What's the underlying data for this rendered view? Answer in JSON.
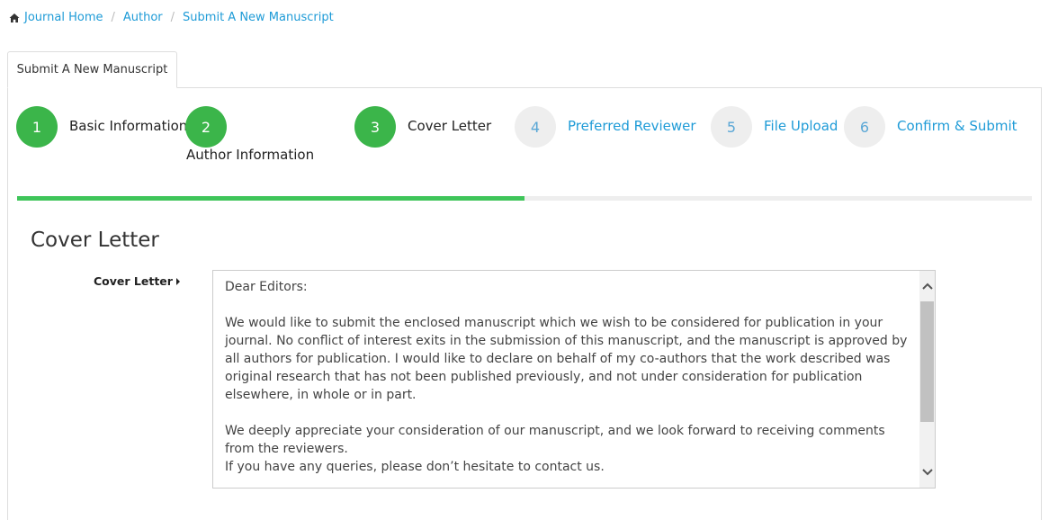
{
  "breadcrumb": {
    "items": [
      "Journal Home",
      "Author",
      "Submit A New Manuscript"
    ],
    "separator": "/"
  },
  "tab": {
    "label": "Submit A New Manuscript"
  },
  "steps": [
    {
      "number": "1",
      "label": "Basic Information",
      "status": "completed"
    },
    {
      "number": "2",
      "label": "Author Information",
      "status": "completed"
    },
    {
      "number": "3",
      "label": "Cover Letter",
      "status": "current"
    },
    {
      "number": "4",
      "label": "Preferred Reviewer",
      "status": "pending"
    },
    {
      "number": "5",
      "label": "File Upload",
      "status": "pending"
    },
    {
      "number": "6",
      "label": "Confirm & Submit",
      "status": "pending"
    }
  ],
  "progress": {
    "percent": 50
  },
  "section": {
    "title": "Cover Letter"
  },
  "cover_letter": {
    "label": "Cover Letter",
    "value": "Dear Editors:\n\nWe would like to submit the enclosed manuscript which we wish to be considered for publication in your journal. No conflict of interest exits in the submission of this manuscript, and the manuscript is approved by all authors for publication. I would like to declare on behalf of my co-authors that the work described was original research that has not been published previously, and not under consideration for publication elsewhere, in whole or in part.\n\nWe deeply appreciate your consideration of our manuscript, and we look forward to receiving comments from the reviewers.\nIf you have any queries, please don’t hesitate to contact us.\n\nThanks a lot."
  },
  "colors": {
    "link": "#1e9bd7",
    "step_done": "#3bb54a",
    "step_pending": "#eeeeee",
    "progress": "#3fc55a"
  },
  "icons": {
    "home": "home-icon",
    "caret": "caret-right-icon",
    "scroll_up": "chevron-up-icon",
    "scroll_down": "chevron-down-icon"
  }
}
